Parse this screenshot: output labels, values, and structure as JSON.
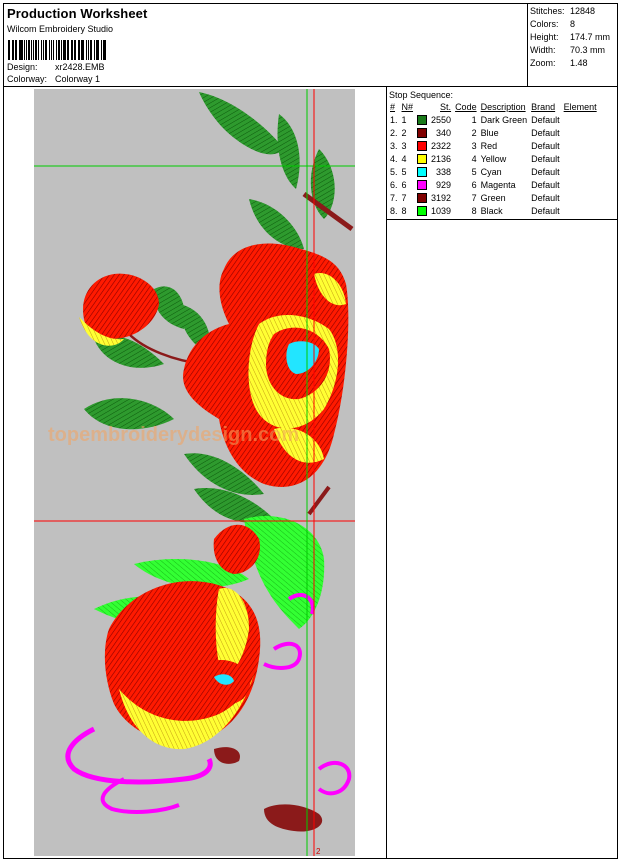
{
  "header": {
    "title": "Production Worksheet",
    "software": "Wilcom Embroidery Studio",
    "design_label": "Design:",
    "design_value": "xr2428.EMB",
    "colorway_label": "Colorway:",
    "colorway_value": "Colorway 1"
  },
  "stats": [
    {
      "label": "Stitches:",
      "value": "12848"
    },
    {
      "label": "Colors:",
      "value": "8"
    },
    {
      "label": "Height:",
      "value": "174.7 mm"
    },
    {
      "label": "Width:",
      "value": "70.3 mm"
    },
    {
      "label": "Zoom:",
      "value": "1.48"
    }
  ],
  "design": {
    "watermark": "topembroiderydesign.com",
    "marker": "2"
  },
  "stop_sequence": {
    "title": "Stop Sequence:",
    "headers": {
      "stop": "#",
      "needle": "N#",
      "stitches": "St.",
      "code": "Code",
      "description": "Description",
      "brand": "Brand",
      "element": "Element"
    },
    "rows": [
      {
        "stop": "1.",
        "needle": "1",
        "color": "#1a7a1a",
        "stitches": "2550",
        "code": "1",
        "description": "Dark Green",
        "brand": "Default",
        "element": ""
      },
      {
        "stop": "2.",
        "needle": "2",
        "color": "#800000",
        "stitches": "340",
        "code": "2",
        "description": "Blue",
        "brand": "Default",
        "element": ""
      },
      {
        "stop": "3.",
        "needle": "3",
        "color": "#ff0000",
        "stitches": "2322",
        "code": "3",
        "description": "Red",
        "brand": "Default",
        "element": ""
      },
      {
        "stop": "4.",
        "needle": "4",
        "color": "#ffff00",
        "stitches": "2136",
        "code": "4",
        "description": "Yellow",
        "brand": "Default",
        "element": ""
      },
      {
        "stop": "5.",
        "needle": "5",
        "color": "#00ffff",
        "stitches": "338",
        "code": "5",
        "description": "Cyan",
        "brand": "Default",
        "element": ""
      },
      {
        "stop": "6.",
        "needle": "6",
        "color": "#ff00ff",
        "stitches": "929",
        "code": "6",
        "description": "Magenta",
        "brand": "Default",
        "element": ""
      },
      {
        "stop": "7.",
        "needle": "7",
        "color": "#800000",
        "stitches": "3192",
        "code": "7",
        "description": "Green",
        "brand": "Default",
        "element": ""
      },
      {
        "stop": "8.",
        "needle": "8",
        "color": "#00ff00",
        "stitches": "1039",
        "code": "8",
        "description": "Black",
        "brand": "Default",
        "element": ""
      }
    ]
  }
}
